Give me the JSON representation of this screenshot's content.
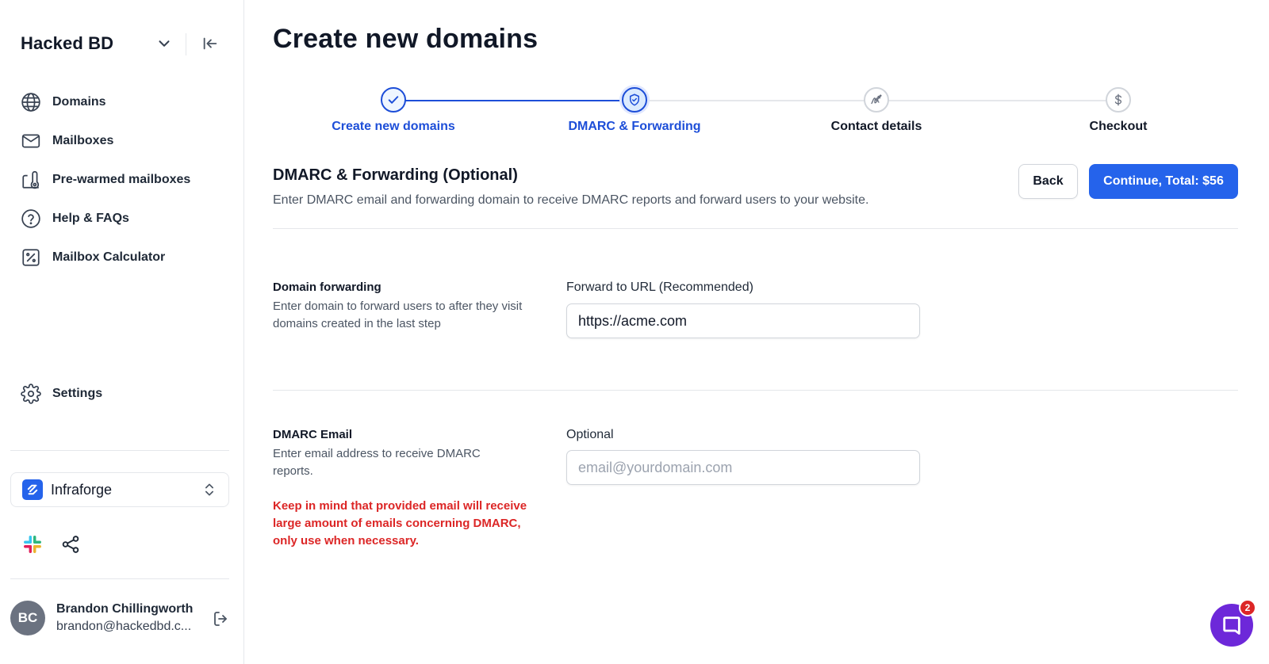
{
  "sidebar": {
    "workspace_name": "Hacked BD",
    "nav_items": [
      {
        "label": "Domains",
        "icon": "globe-icon"
      },
      {
        "label": "Mailboxes",
        "icon": "mail-icon"
      },
      {
        "label": "Pre-warmed mailboxes",
        "icon": "thermometer-icon"
      },
      {
        "label": "Help & FAQs",
        "icon": "help-circle-icon"
      },
      {
        "label": "Mailbox Calculator",
        "icon": "calculator-icon"
      }
    ],
    "settings_label": "Settings",
    "org_name": "Infraforge",
    "user": {
      "initials": "BC",
      "name": "Brandon Chillingworth",
      "email": "brandon@hackedbd.c..."
    }
  },
  "main": {
    "title": "Create new domains",
    "steps": [
      {
        "label": "Create new domains",
        "state": "done",
        "icon": "check-icon"
      },
      {
        "label": "DMARC & Forwarding",
        "state": "current",
        "icon": "shield-icon"
      },
      {
        "label": "Contact details",
        "state": "upcoming",
        "icon": "signature-icon"
      },
      {
        "label": "Checkout",
        "state": "upcoming",
        "icon": "dollar-icon"
      }
    ],
    "section": {
      "title": "DMARC & Forwarding (Optional)",
      "description": "Enter DMARC email and forwarding domain to receive DMARC reports and forward users to your website."
    },
    "actions": {
      "back_label": "Back",
      "continue_label": "Continue, Total: $56"
    },
    "forwarding": {
      "title": "Domain forwarding",
      "description": "Enter domain to forward users to after they visit domains created in the last step",
      "input_label": "Forward to URL (Recommended)",
      "value": "https://acme.com"
    },
    "dmarc": {
      "title": "DMARC Email",
      "description": "Enter email address to receive DMARC reports.",
      "warning": "Keep in mind that provided email will receive large amount of emails concerning DMARC, only use when necessary.",
      "input_label": "Optional",
      "placeholder": "email@yourdomain.com",
      "value": ""
    }
  },
  "chat": {
    "badge_count": "2"
  },
  "colors": {
    "accent": "#2563eb",
    "step_active": "#1d4ed8",
    "warning": "#dc2626",
    "chat": "#6d28d9"
  }
}
